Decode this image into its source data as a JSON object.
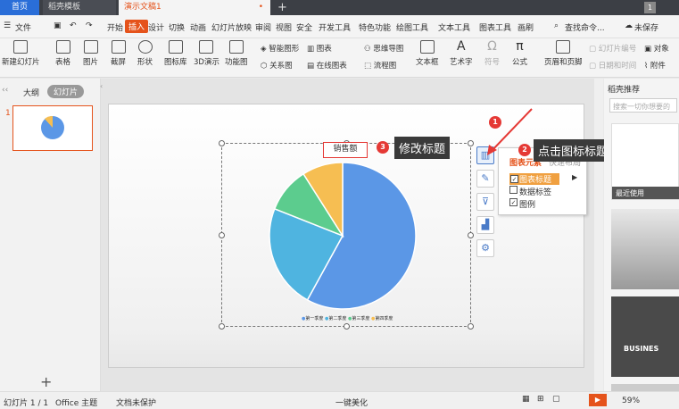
{
  "tabs": {
    "home": "首页",
    "doc": "稻壳模板",
    "active": "演示文稿1"
  },
  "menu": {
    "file": "文件",
    "items": [
      "开始",
      "插入",
      "设计",
      "切换",
      "动画",
      "幻灯片放映",
      "审阅",
      "视图",
      "安全",
      "开发工具",
      "特色功能",
      "绘图工具",
      "文本工具",
      "图表工具",
      "画刷"
    ],
    "search": "查找命令...",
    "save": "未保存"
  },
  "ribbon": {
    "new_slide": "新建幻灯片",
    "table": "表格",
    "picture": "图片",
    "screenshot": "截屏",
    "shape": "形状",
    "icons": "图标库",
    "threed": "3D演示",
    "func_chart": "功能图",
    "smartart": "智能图形",
    "chart": "图表",
    "relation": "关系图",
    "online_chart": "在线图表",
    "mindmap": "思维导图",
    "flowchart": "流程图",
    "textbox": "文本框",
    "wordart": "艺术字",
    "symbol": "符号",
    "formula": "公式",
    "header_footer": "页眉和页脚",
    "slide_no": "幻灯片编号",
    "datetime": "日期和时间",
    "object": "对象",
    "attach": "附件"
  },
  "left_panel": {
    "outline": "大纲",
    "slides": "幻灯片",
    "slide_number": "1"
  },
  "chart": {
    "title": "销售额",
    "legend": [
      "第一季度",
      "第二季度",
      "第三季度",
      "第四季度"
    ]
  },
  "chart_data": {
    "type": "pie",
    "title": "销售额",
    "categories": [
      "第一季度",
      "第二季度",
      "第三季度",
      "第四季度"
    ],
    "values": [
      58,
      23,
      10,
      9
    ],
    "colors": [
      "#5b97e6",
      "#4fb4e0",
      "#5ccc8e",
      "#f6be52"
    ]
  },
  "popup": {
    "header": "图表元素",
    "tab2": "快速布局",
    "items": [
      {
        "label": "图表标题",
        "checked": true
      },
      {
        "label": "数据标签",
        "checked": false
      },
      {
        "label": "图例",
        "checked": true
      }
    ]
  },
  "callouts": {
    "c1": "修改标题",
    "c2": "点击图标标题",
    "n1": "1",
    "n2": "2",
    "n3": "3"
  },
  "right_panel": {
    "title": "稻壳推荐",
    "search": "搜索一切你想要的",
    "recent": "最近使用",
    "business": "BUSINES"
  },
  "status": {
    "slide": "幻灯片 1 / 1",
    "theme": "Office 主题",
    "protect": "文档未保护",
    "beautify": "一键美化",
    "zoom": "59%"
  }
}
